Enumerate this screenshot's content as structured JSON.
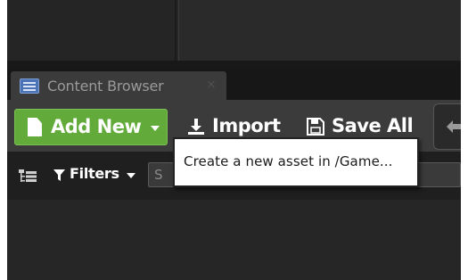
{
  "content_browser_tab": {
    "label": "Content Browser",
    "close_glyph": "×",
    "icon": "content-browser-icon"
  },
  "toolbar": {
    "add_new_label": "Add New",
    "add_new_icon": "new-document-icon",
    "import_label": "Import",
    "import_icon": "import-download-icon",
    "save_all_label": "Save All",
    "save_all_icon": "floppy-disk-icon",
    "back_icon": "back-arrow-icon"
  },
  "filter_bar": {
    "sources_icon": "folder-tree-icon",
    "filters_label": "Filters",
    "filters_icon": "funnel-icon",
    "search_value": "S"
  },
  "tooltip": {
    "text": "Create a new asset in /Game..."
  },
  "colors": {
    "add_new_green": "#62ab3b",
    "toolbar_bg": "#3b3b3b",
    "editor_bg": "#262626",
    "tooltip_bg": "#ffffff"
  }
}
